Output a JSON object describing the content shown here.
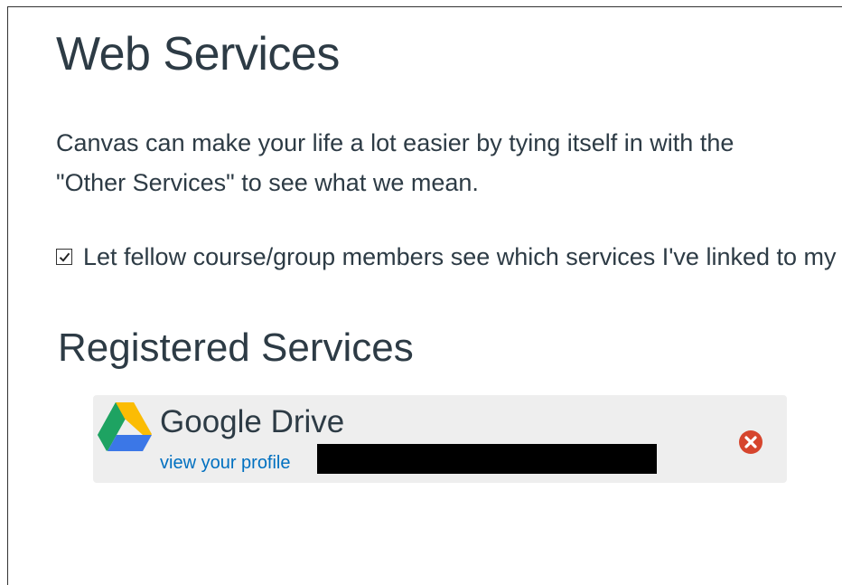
{
  "page": {
    "title": "Web Services",
    "intro_line1": "Canvas can make your life a lot easier by tying itself in with the",
    "intro_line2": "\"Other Services\" to see what we mean."
  },
  "visibility_setting": {
    "label": "Let fellow course/group members see which services I've linked to my profile",
    "checked": true
  },
  "registered_services": {
    "title": "Registered Services",
    "items": [
      {
        "name": "Google Drive",
        "icon": "google-drive-icon",
        "profile_link_label": "view your profile",
        "remove_icon": "remove-circle-icon"
      }
    ]
  },
  "colors": {
    "text": "#2d3b45",
    "link": "#0070c0",
    "card_bg": "#eeeeee",
    "remove_red": "#d6452d"
  }
}
